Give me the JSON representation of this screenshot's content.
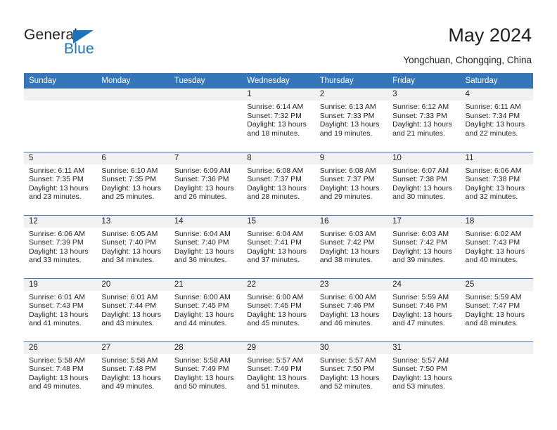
{
  "brand": {
    "name_part1": "General",
    "name_part2": "Blue"
  },
  "header": {
    "title": "May 2024",
    "location": "Yongchuan, Chongqing, China"
  },
  "colors": {
    "header_blue": "#3476b8",
    "brand_blue": "#1b73bc",
    "band_gray": "#f1f1f1",
    "text": "#231f20"
  },
  "weekday_headers": [
    "Sunday",
    "Monday",
    "Tuesday",
    "Wednesday",
    "Thursday",
    "Friday",
    "Saturday"
  ],
  "weeks": [
    [
      {
        "day": "",
        "sunrise": "",
        "sunset": "",
        "daylight1": "",
        "daylight2": ""
      },
      {
        "day": "",
        "sunrise": "",
        "sunset": "",
        "daylight1": "",
        "daylight2": ""
      },
      {
        "day": "",
        "sunrise": "",
        "sunset": "",
        "daylight1": "",
        "daylight2": ""
      },
      {
        "day": "1",
        "sunrise": "Sunrise: 6:14 AM",
        "sunset": "Sunset: 7:32 PM",
        "daylight1": "Daylight: 13 hours",
        "daylight2": "and 18 minutes."
      },
      {
        "day": "2",
        "sunrise": "Sunrise: 6:13 AM",
        "sunset": "Sunset: 7:33 PM",
        "daylight1": "Daylight: 13 hours",
        "daylight2": "and 19 minutes."
      },
      {
        "day": "3",
        "sunrise": "Sunrise: 6:12 AM",
        "sunset": "Sunset: 7:33 PM",
        "daylight1": "Daylight: 13 hours",
        "daylight2": "and 21 minutes."
      },
      {
        "day": "4",
        "sunrise": "Sunrise: 6:11 AM",
        "sunset": "Sunset: 7:34 PM",
        "daylight1": "Daylight: 13 hours",
        "daylight2": "and 22 minutes."
      }
    ],
    [
      {
        "day": "5",
        "sunrise": "Sunrise: 6:11 AM",
        "sunset": "Sunset: 7:35 PM",
        "daylight1": "Daylight: 13 hours",
        "daylight2": "and 23 minutes."
      },
      {
        "day": "6",
        "sunrise": "Sunrise: 6:10 AM",
        "sunset": "Sunset: 7:35 PM",
        "daylight1": "Daylight: 13 hours",
        "daylight2": "and 25 minutes."
      },
      {
        "day": "7",
        "sunrise": "Sunrise: 6:09 AM",
        "sunset": "Sunset: 7:36 PM",
        "daylight1": "Daylight: 13 hours",
        "daylight2": "and 26 minutes."
      },
      {
        "day": "8",
        "sunrise": "Sunrise: 6:08 AM",
        "sunset": "Sunset: 7:37 PM",
        "daylight1": "Daylight: 13 hours",
        "daylight2": "and 28 minutes."
      },
      {
        "day": "9",
        "sunrise": "Sunrise: 6:08 AM",
        "sunset": "Sunset: 7:37 PM",
        "daylight1": "Daylight: 13 hours",
        "daylight2": "and 29 minutes."
      },
      {
        "day": "10",
        "sunrise": "Sunrise: 6:07 AM",
        "sunset": "Sunset: 7:38 PM",
        "daylight1": "Daylight: 13 hours",
        "daylight2": "and 30 minutes."
      },
      {
        "day": "11",
        "sunrise": "Sunrise: 6:06 AM",
        "sunset": "Sunset: 7:38 PM",
        "daylight1": "Daylight: 13 hours",
        "daylight2": "and 32 minutes."
      }
    ],
    [
      {
        "day": "12",
        "sunrise": "Sunrise: 6:06 AM",
        "sunset": "Sunset: 7:39 PM",
        "daylight1": "Daylight: 13 hours",
        "daylight2": "and 33 minutes."
      },
      {
        "day": "13",
        "sunrise": "Sunrise: 6:05 AM",
        "sunset": "Sunset: 7:40 PM",
        "daylight1": "Daylight: 13 hours",
        "daylight2": "and 34 minutes."
      },
      {
        "day": "14",
        "sunrise": "Sunrise: 6:04 AM",
        "sunset": "Sunset: 7:40 PM",
        "daylight1": "Daylight: 13 hours",
        "daylight2": "and 36 minutes."
      },
      {
        "day": "15",
        "sunrise": "Sunrise: 6:04 AM",
        "sunset": "Sunset: 7:41 PM",
        "daylight1": "Daylight: 13 hours",
        "daylight2": "and 37 minutes."
      },
      {
        "day": "16",
        "sunrise": "Sunrise: 6:03 AM",
        "sunset": "Sunset: 7:42 PM",
        "daylight1": "Daylight: 13 hours",
        "daylight2": "and 38 minutes."
      },
      {
        "day": "17",
        "sunrise": "Sunrise: 6:03 AM",
        "sunset": "Sunset: 7:42 PM",
        "daylight1": "Daylight: 13 hours",
        "daylight2": "and 39 minutes."
      },
      {
        "day": "18",
        "sunrise": "Sunrise: 6:02 AM",
        "sunset": "Sunset: 7:43 PM",
        "daylight1": "Daylight: 13 hours",
        "daylight2": "and 40 minutes."
      }
    ],
    [
      {
        "day": "19",
        "sunrise": "Sunrise: 6:01 AM",
        "sunset": "Sunset: 7:43 PM",
        "daylight1": "Daylight: 13 hours",
        "daylight2": "and 41 minutes."
      },
      {
        "day": "20",
        "sunrise": "Sunrise: 6:01 AM",
        "sunset": "Sunset: 7:44 PM",
        "daylight1": "Daylight: 13 hours",
        "daylight2": "and 43 minutes."
      },
      {
        "day": "21",
        "sunrise": "Sunrise: 6:00 AM",
        "sunset": "Sunset: 7:45 PM",
        "daylight1": "Daylight: 13 hours",
        "daylight2": "and 44 minutes."
      },
      {
        "day": "22",
        "sunrise": "Sunrise: 6:00 AM",
        "sunset": "Sunset: 7:45 PM",
        "daylight1": "Daylight: 13 hours",
        "daylight2": "and 45 minutes."
      },
      {
        "day": "23",
        "sunrise": "Sunrise: 6:00 AM",
        "sunset": "Sunset: 7:46 PM",
        "daylight1": "Daylight: 13 hours",
        "daylight2": "and 46 minutes."
      },
      {
        "day": "24",
        "sunrise": "Sunrise: 5:59 AM",
        "sunset": "Sunset: 7:46 PM",
        "daylight1": "Daylight: 13 hours",
        "daylight2": "and 47 minutes."
      },
      {
        "day": "25",
        "sunrise": "Sunrise: 5:59 AM",
        "sunset": "Sunset: 7:47 PM",
        "daylight1": "Daylight: 13 hours",
        "daylight2": "and 48 minutes."
      }
    ],
    [
      {
        "day": "26",
        "sunrise": "Sunrise: 5:58 AM",
        "sunset": "Sunset: 7:48 PM",
        "daylight1": "Daylight: 13 hours",
        "daylight2": "and 49 minutes."
      },
      {
        "day": "27",
        "sunrise": "Sunrise: 5:58 AM",
        "sunset": "Sunset: 7:48 PM",
        "daylight1": "Daylight: 13 hours",
        "daylight2": "and 49 minutes."
      },
      {
        "day": "28",
        "sunrise": "Sunrise: 5:58 AM",
        "sunset": "Sunset: 7:49 PM",
        "daylight1": "Daylight: 13 hours",
        "daylight2": "and 50 minutes."
      },
      {
        "day": "29",
        "sunrise": "Sunrise: 5:57 AM",
        "sunset": "Sunset: 7:49 PM",
        "daylight1": "Daylight: 13 hours",
        "daylight2": "and 51 minutes."
      },
      {
        "day": "30",
        "sunrise": "Sunrise: 5:57 AM",
        "sunset": "Sunset: 7:50 PM",
        "daylight1": "Daylight: 13 hours",
        "daylight2": "and 52 minutes."
      },
      {
        "day": "31",
        "sunrise": "Sunrise: 5:57 AM",
        "sunset": "Sunset: 7:50 PM",
        "daylight1": "Daylight: 13 hours",
        "daylight2": "and 53 minutes."
      },
      {
        "day": "",
        "sunrise": "",
        "sunset": "",
        "daylight1": "",
        "daylight2": ""
      }
    ]
  ]
}
